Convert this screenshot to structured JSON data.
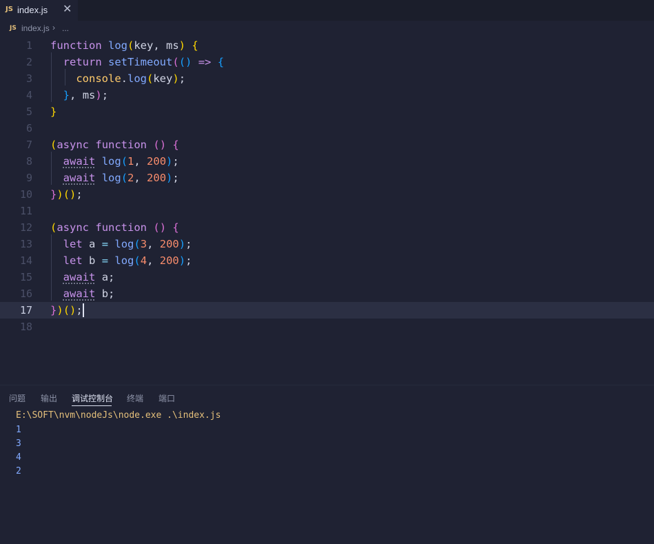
{
  "tab": {
    "icon": "JS",
    "filename": "index.js",
    "close": "✕"
  },
  "breadcrumb": {
    "icon": "JS",
    "file": "index.js",
    "sep": "›",
    "more": "..."
  },
  "editor": {
    "line_numbers": [
      "1",
      "2",
      "3",
      "4",
      "5",
      "6",
      "7",
      "8",
      "9",
      "10",
      "11",
      "12",
      "13",
      "14",
      "15",
      "16",
      "17",
      "18"
    ],
    "current_line": "17",
    "lines": [
      "function log(key, ms) {",
      "  return setTimeout(() => {",
      "    console.log(key);",
      "  }, ms);",
      "}",
      "",
      "(async function () {",
      "  await log(1, 200);",
      "  await log(2, 200);",
      "})();",
      "",
      "(async function () {",
      "  let a = log(3, 200);",
      "  let b = log(4, 200);",
      "  await a;",
      "  await b;",
      "})();",
      ""
    ]
  },
  "panel": {
    "tabs": [
      "问题",
      "输出",
      "调试控制台",
      "终端",
      "端口"
    ],
    "active_tab": "调试控制台",
    "output": {
      "command": "E:\\SOFT\\nvm\\nodeJs\\node.exe .\\index.js",
      "values": [
        "1",
        "3",
        "4",
        "2"
      ]
    }
  },
  "colors": {
    "background": "#1f2233",
    "keyword": "#c792ea",
    "function": "#82aaff",
    "number": "#f78c6c",
    "bracket_level1": "#ffd700",
    "bracket_level2": "#da70d6",
    "bracket_level3": "#179fff"
  }
}
